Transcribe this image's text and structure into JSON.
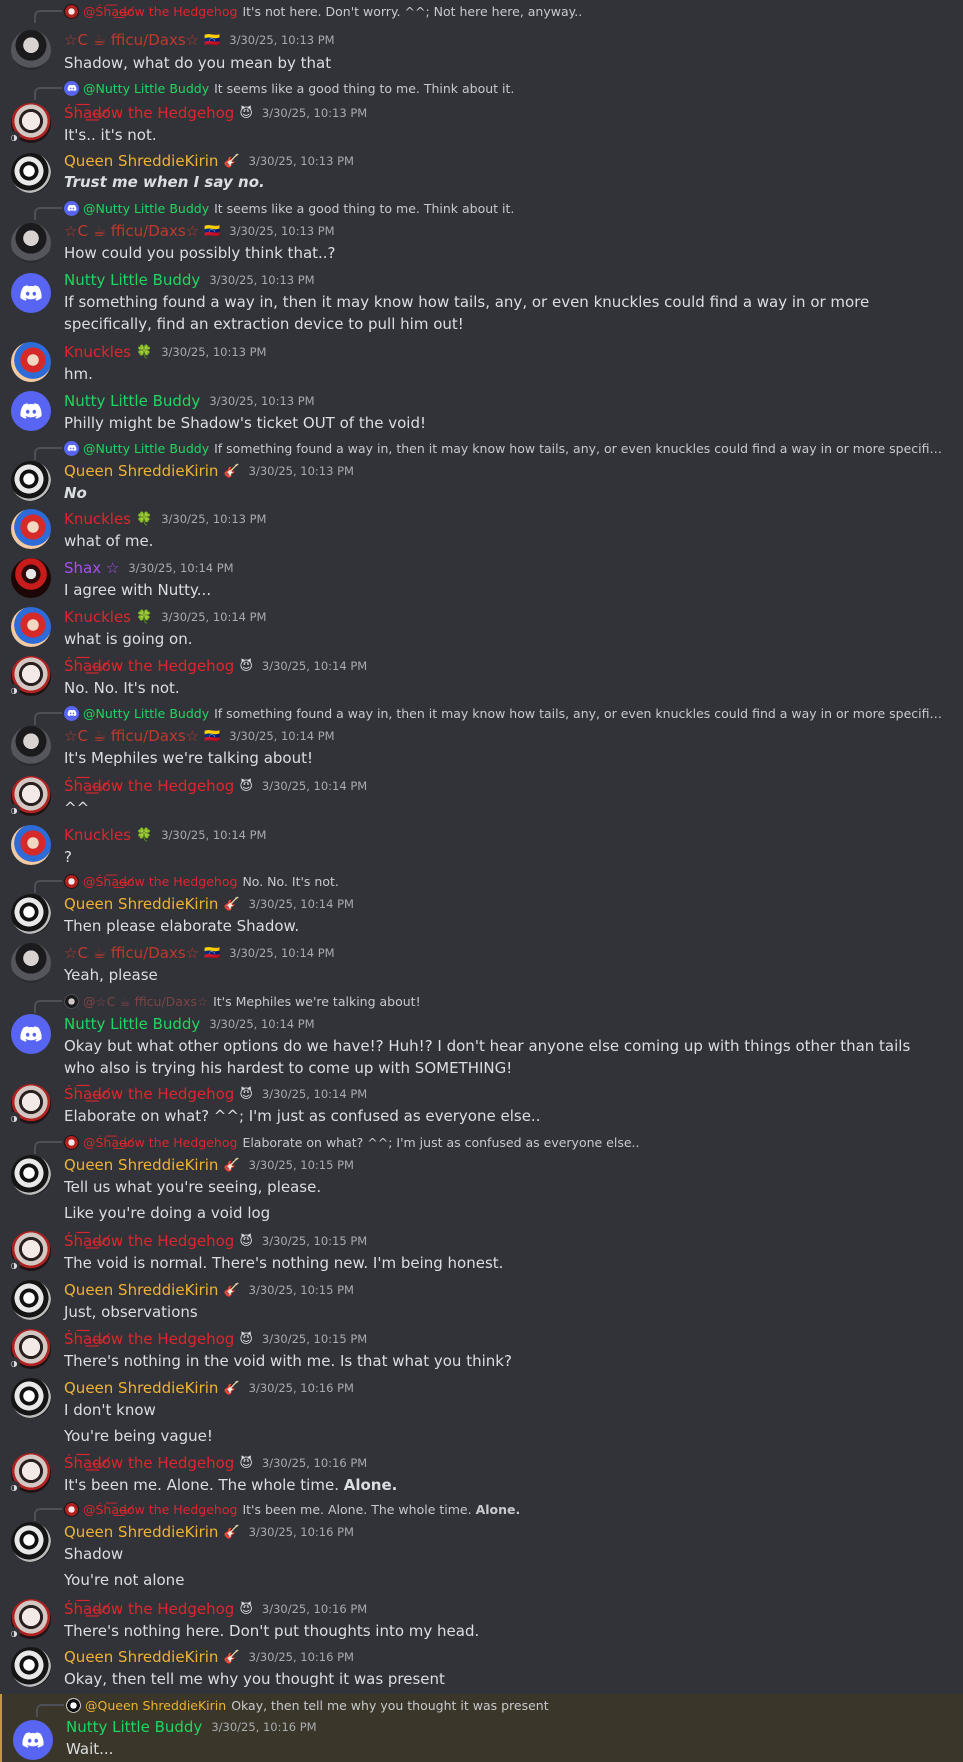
{
  "colors": {
    "background": "#313338",
    "shadow": "#e0242d",
    "queen": "#f0b232",
    "nutty": "#1ed760",
    "knuckles": "#e0242d",
    "shax": "#a74ff2",
    "dax": "#c0392b"
  },
  "names": {
    "shadow": "Ṡh͞a͟d̶o̸w the Hedgehog",
    "shadow_reply": "@Ṡh͞a͟d̶o̸w the Hedgehog",
    "dax": "☆C ☕ fficu/Daxs☆",
    "dax_reply": "@☆C ☕ fficu/Daxs☆",
    "queen": "Queen ShreddieKirin",
    "queen_reply": "@Queen ShreddieKirin",
    "nutty": "Nutty Little Buddy",
    "nutty_reply": "@Nutty Little Buddy",
    "knuckles": "Knuckles",
    "shax": "Shax ☆"
  },
  "badges": {
    "shadow": "😈",
    "dax": "🇻🇪",
    "queen": "🎸",
    "knuckles": "🍀"
  },
  "icons": {
    "discord": "discord-logo-icon",
    "reply": "reply-connector"
  },
  "messages": [
    {
      "reply": "It's not here. Don't worry. ^^; Not here here, anyway..",
      "ts": "3/30/25, 10:13 PM",
      "text": "Shadow, what do you mean by that"
    },
    {
      "reply": "It seems like a good thing to me. Think about it.",
      "ts": "3/30/25, 10:13 PM",
      "text": "It's.. it's not."
    },
    {
      "ts": "3/30/25, 10:13 PM",
      "text": "Trust me when I say no."
    },
    {
      "reply": "It seems like a good thing to me. Think about it.",
      "ts": "3/30/25, 10:13 PM",
      "text": "How could you possibly think that..?"
    },
    {
      "ts": "3/30/25, 10:13 PM",
      "text": "If something found a way in, then it may know how tails, any, or even knuckles could find a way in or more specifically, find an extraction device to pull him out!"
    },
    {
      "ts": "3/30/25, 10:13 PM",
      "text": "hm."
    },
    {
      "ts": "3/30/25, 10:13 PM",
      "text": "Philly might be Shadow's ticket OUT of the void!"
    },
    {
      "reply": "If something found a way in, then it may know how tails, any, or even knuckles could find a way in or more specifically, find …",
      "ts": "3/30/25, 10:13 PM",
      "text": "No"
    },
    {
      "ts": "3/30/25, 10:13 PM",
      "text": "what of me."
    },
    {
      "ts": "3/30/25, 10:14 PM",
      "text": "I agree with Nutty..."
    },
    {
      "ts": "3/30/25, 10:14 PM",
      "text": "what is going on."
    },
    {
      "ts": "3/30/25, 10:14 PM",
      "text": "No. No. It's not."
    },
    {
      "reply": "If something found a way in, then it may know how tails, any, or even knuckles could find a way in or more specifically, find …",
      "ts": "3/30/25, 10:14 PM",
      "text": "It's Mephiles we're talking about!"
    },
    {
      "ts": "3/30/25, 10:14 PM",
      "text": "^^"
    },
    {
      "ts": "3/30/25, 10:14 PM",
      "text": "?"
    },
    {
      "reply": "No. No. It's not.",
      "ts": "3/30/25, 10:14 PM",
      "text": "Then please elaborate Shadow."
    },
    {
      "ts": "3/30/25, 10:14 PM",
      "text": "Yeah, please"
    },
    {
      "reply": "It's Mephiles we're talking about!",
      "ts": "3/30/25, 10:14 PM",
      "text": "Okay but what other options do we have!? Huh!? I don't hear anyone else coming up with things other than tails who also is trying his hardest to come up with SOMETHING!"
    },
    {
      "ts": "3/30/25, 10:14 PM",
      "text": "Elaborate on what? ^^; I'm just as confused as everyone else.."
    },
    {
      "reply": "Elaborate on what? ^^; I'm just as confused as everyone else..",
      "ts": "3/30/25, 10:15 PM",
      "text": "Tell us what you're seeing, please.",
      "text2": "Like you're doing a void log"
    },
    {
      "ts": "3/30/25, 10:15 PM",
      "text": "The void is normal. There's nothing new. I'm being honest."
    },
    {
      "ts": "3/30/25, 10:15 PM",
      "text": "Just, observations"
    },
    {
      "ts": "3/30/25, 10:15 PM",
      "text": "There's nothing in the void with me. Is that what you think?"
    },
    {
      "ts": "3/30/25, 10:16 PM",
      "text": "I don't know",
      "text2": "You're being vague!"
    },
    {
      "ts": "3/30/25, 10:16 PM",
      "text": "It's been me. Alone. The whole time.",
      "bold": "Alone."
    },
    {
      "reply": "It's been me. Alone. The whole time.",
      "reply_bold": "Alone.",
      "ts": "3/30/25, 10:16 PM",
      "text": "Shadow",
      "text2": "You're not alone"
    },
    {
      "ts": "3/30/25, 10:16 PM",
      "text": "There's nothing here. Don't put thoughts into my head."
    },
    {
      "ts": "3/30/25, 10:16 PM",
      "text": "Okay, then tell me why you thought it was present"
    },
    {
      "reply": "Okay, then tell me why you thought it was present",
      "ts": "3/30/25, 10:16 PM",
      "text": "Wait..."
    }
  ]
}
